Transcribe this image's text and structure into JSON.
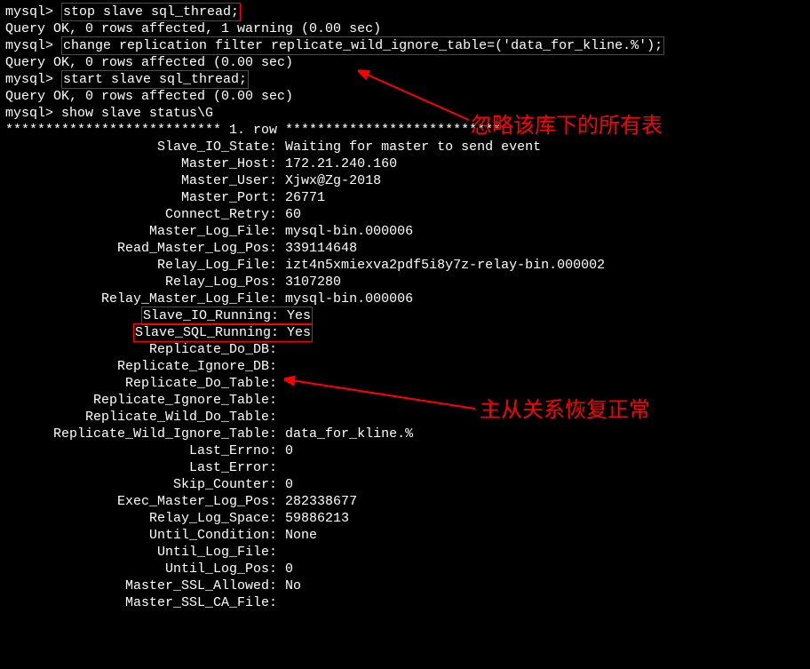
{
  "prompt": "mysql> ",
  "cmd1": "stop slave sql_thread;",
  "ok1": "Query OK, 0 rows affected, 1 warning (0.00 sec)",
  "cmd2": "change replication filter replicate_wild_ignore_table=('data_for_kline.%');",
  "ok2": "Query OK, 0 rows affected (0.00 sec)",
  "cmd3": "start slave sql_thread;",
  "ok3": "Query OK, 0 rows affected (0.00 sec)",
  "cmd4": "show slave status\\G",
  "rowsep": "*************************** 1. row ***************************",
  "status": [
    {
      "k": "Slave_IO_State",
      "v": "Waiting for master to send event"
    },
    {
      "k": "Master_Host",
      "v": "172.21.240.160"
    },
    {
      "k": "Master_User",
      "v": "Xjwx@Zg-2018"
    },
    {
      "k": "Master_Port",
      "v": "26771"
    },
    {
      "k": "Connect_Retry",
      "v": "60"
    },
    {
      "k": "Master_Log_File",
      "v": "mysql-bin.000006"
    },
    {
      "k": "Read_Master_Log_Pos",
      "v": "339114648"
    },
    {
      "k": "Relay_Log_File",
      "v": "izt4n5xmiexva2pdf5i8y7z-relay-bin.000002"
    },
    {
      "k": "Relay_Log_Pos",
      "v": "3107280"
    },
    {
      "k": "Relay_Master_Log_File",
      "v": "mysql-bin.000006"
    },
    {
      "k": "Slave_IO_Running",
      "v": "Yes",
      "boxed": true
    },
    {
      "k": "Slave_SQL_Running",
      "v": "Yes",
      "boxed": true
    },
    {
      "k": "Replicate_Do_DB",
      "v": ""
    },
    {
      "k": "Replicate_Ignore_DB",
      "v": ""
    },
    {
      "k": "Replicate_Do_Table",
      "v": ""
    },
    {
      "k": "Replicate_Ignore_Table",
      "v": ""
    },
    {
      "k": "Replicate_Wild_Do_Table",
      "v": ""
    },
    {
      "k": "Replicate_Wild_Ignore_Table",
      "v": "data_for_kline.%"
    },
    {
      "k": "Last_Errno",
      "v": "0"
    },
    {
      "k": "Last_Error",
      "v": ""
    },
    {
      "k": "Skip_Counter",
      "v": "0"
    },
    {
      "k": "Exec_Master_Log_Pos",
      "v": "282338677"
    },
    {
      "k": "Relay_Log_Space",
      "v": "59886213"
    },
    {
      "k": "Until_Condition",
      "v": "None"
    },
    {
      "k": "Until_Log_File",
      "v": ""
    },
    {
      "k": "Until_Log_Pos",
      "v": "0"
    },
    {
      "k": "Master_SSL_Allowed",
      "v": "No"
    },
    {
      "k": "Master_SSL_CA_File",
      "v": ""
    }
  ],
  "label_width": 33,
  "annotation1": "忽略该库下的所有表",
  "annotation2": "主从关系恢复正常"
}
